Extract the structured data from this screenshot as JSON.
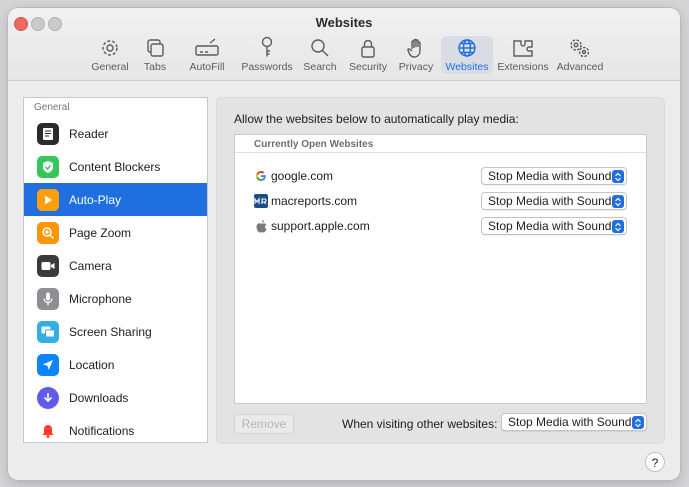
{
  "window": {
    "title": "Websites"
  },
  "toolbar": {
    "items": [
      {
        "label": "General",
        "icon": "gear-icon"
      },
      {
        "label": "Tabs",
        "icon": "tabs-icon"
      },
      {
        "label": "AutoFill",
        "icon": "autofill-icon"
      },
      {
        "label": "Passwords",
        "icon": "key-icon"
      },
      {
        "label": "Search",
        "icon": "search-icon"
      },
      {
        "label": "Security",
        "icon": "lock-icon"
      },
      {
        "label": "Privacy",
        "icon": "hand-icon"
      },
      {
        "label": "Websites",
        "icon": "globe-icon",
        "active": true
      },
      {
        "label": "Extensions",
        "icon": "puzzle-icon"
      },
      {
        "label": "Advanced",
        "icon": "gears-icon"
      }
    ]
  },
  "sidebar": {
    "section": "General",
    "items": [
      {
        "label": "Reader",
        "icon": "reader-icon",
        "color": "#2b2b2b"
      },
      {
        "label": "Content Blockers",
        "icon": "shield-check-icon",
        "color": "#34c759"
      },
      {
        "label": "Auto-Play",
        "icon": "play-icon",
        "color": "#ff9f0a",
        "selected": true
      },
      {
        "label": "Page Zoom",
        "icon": "zoom-icon",
        "color": "#ff9500"
      },
      {
        "label": "Camera",
        "icon": "camera-icon",
        "color": "#3a3a3c"
      },
      {
        "label": "Microphone",
        "icon": "microphone-icon",
        "color": "#8e8e93"
      },
      {
        "label": "Screen Sharing",
        "icon": "screen-sharing-icon",
        "color": "#32ade6"
      },
      {
        "label": "Location",
        "icon": "location-icon",
        "color": "#0a84ff"
      },
      {
        "label": "Downloads",
        "icon": "download-icon",
        "color": "#5e5ce6"
      },
      {
        "label": "Notifications",
        "icon": "bell-icon",
        "color": "#ff3b30"
      }
    ]
  },
  "main": {
    "heading": "Allow the websites below to automatically play media:",
    "list_header": "Currently Open Websites",
    "sites": [
      {
        "name": "google.com",
        "setting": "Stop Media with Sound",
        "favicon": "google-icon"
      },
      {
        "name": "macreports.com",
        "setting": "Stop Media with Sound",
        "favicon": "mr-icon"
      },
      {
        "name": "support.apple.com",
        "setting": "Stop Media with Sound",
        "favicon": "apple-icon"
      }
    ],
    "remove_label": "Remove",
    "other_label": "When visiting other websites:",
    "other_setting": "Stop Media with Sound"
  },
  "help": {
    "label": "?"
  },
  "colors": {
    "accent": "#1f6fe0",
    "close": "#ed6a5e"
  }
}
